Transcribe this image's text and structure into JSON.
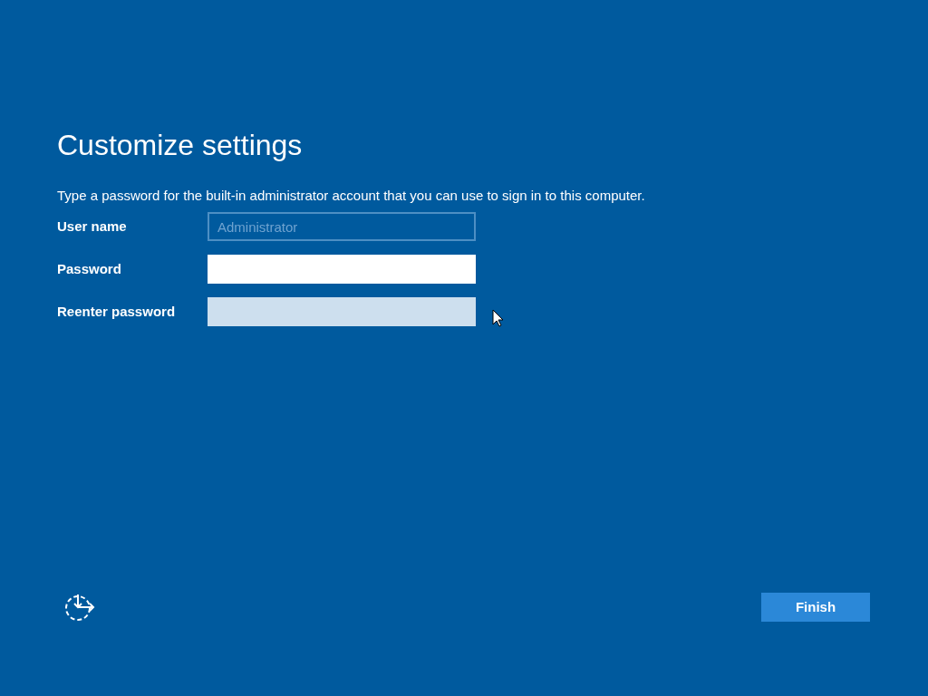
{
  "title": "Customize settings",
  "description": "Type a password for the built-in administrator account that you can use to sign in to this computer.",
  "fields": [
    {
      "label": "User name",
      "value": "Administrator",
      "disabled": true,
      "focused": false
    },
    {
      "label": "Password",
      "disabled": false,
      "focused": true
    },
    {
      "label": "Reenter password",
      "disabled": false,
      "focused": false
    }
  ],
  "finish_button": "Finish"
}
